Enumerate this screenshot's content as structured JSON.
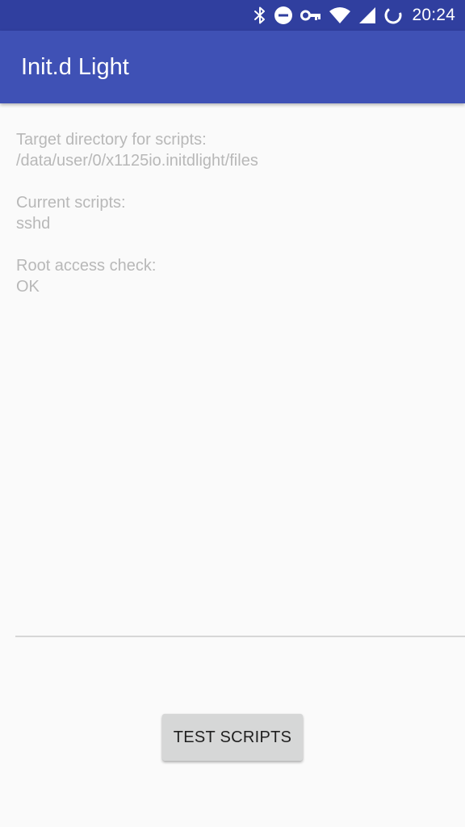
{
  "status_bar": {
    "time": "20:24",
    "icons": [
      "bluetooth-icon",
      "do-not-disturb-icon",
      "vpn-key-icon",
      "wifi-icon",
      "cellular-signal-icon",
      "battery-icon"
    ],
    "background_color": "#303f9f"
  },
  "app_bar": {
    "title": "Init.d Light",
    "background_color": "#3f51b5"
  },
  "info": {
    "target_dir_label": "Target directory for scripts:",
    "target_dir_value": "/data/user/0/x1125io.initdlight/files",
    "current_scripts_label": "Current scripts:",
    "current_scripts_value": "sshd",
    "root_check_label": "Root access check:",
    "root_check_value": "OK"
  },
  "actions": {
    "test_scripts_label": "TEST SCRIPTS"
  }
}
